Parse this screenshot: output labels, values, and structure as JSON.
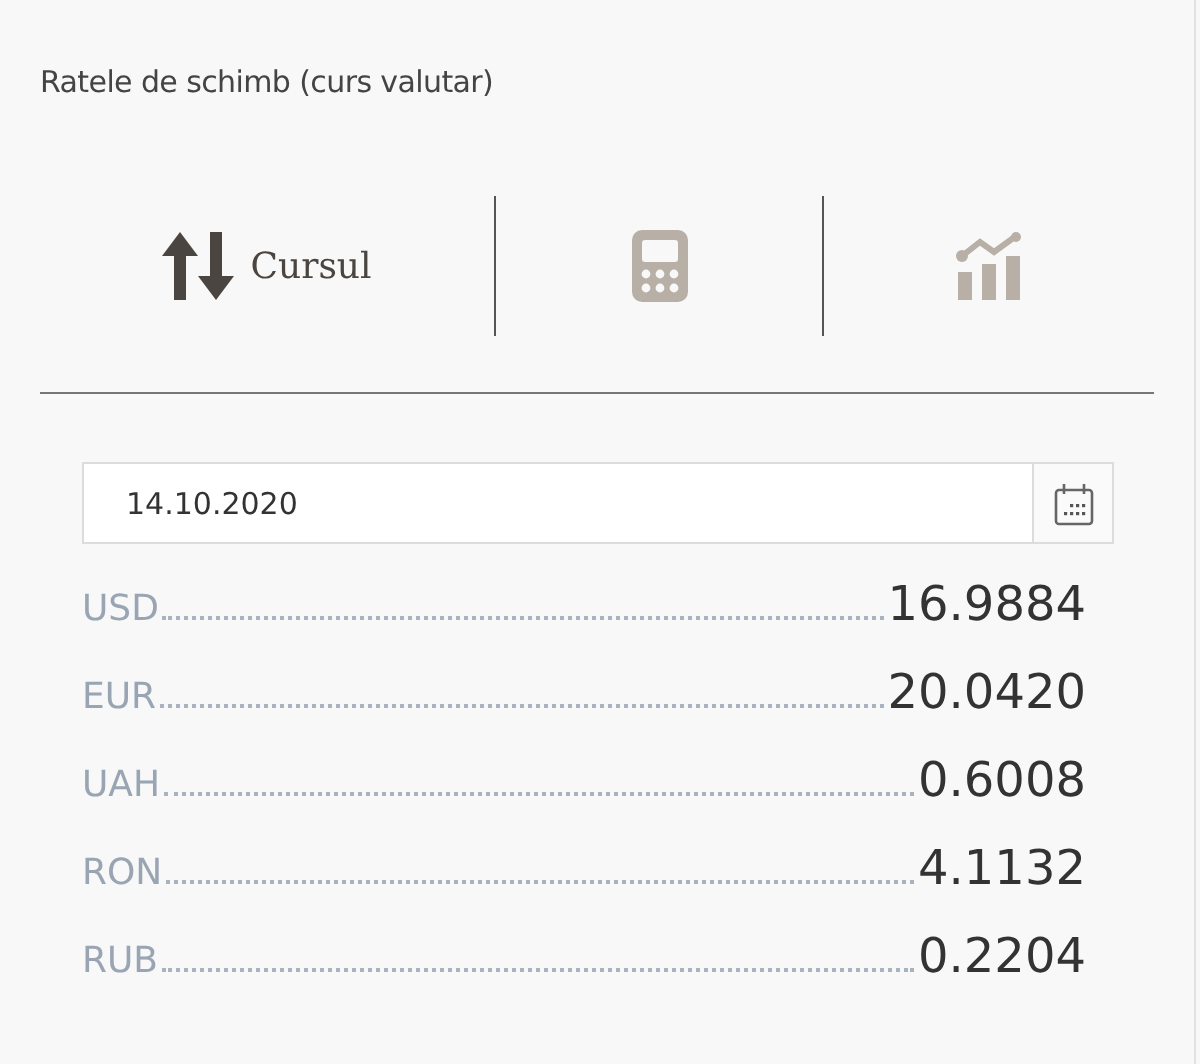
{
  "title": "Ratele de schimb (curs valutar)",
  "tabs": [
    {
      "kind": "arrows",
      "label": "Cursul",
      "selected": true
    },
    {
      "kind": "calculator",
      "selected": false
    },
    {
      "kind": "chart",
      "selected": false
    }
  ],
  "date_field": {
    "value": "14.10.2020"
  },
  "rates": [
    {
      "code": "USD",
      "value": "16.9884"
    },
    {
      "code": "EUR",
      "value": "20.0420"
    },
    {
      "code": "UAH",
      "value": "0.6008"
    },
    {
      "code": "RON",
      "value": "4.1132"
    },
    {
      "code": "RUB",
      "value": "0.2204"
    }
  ]
}
